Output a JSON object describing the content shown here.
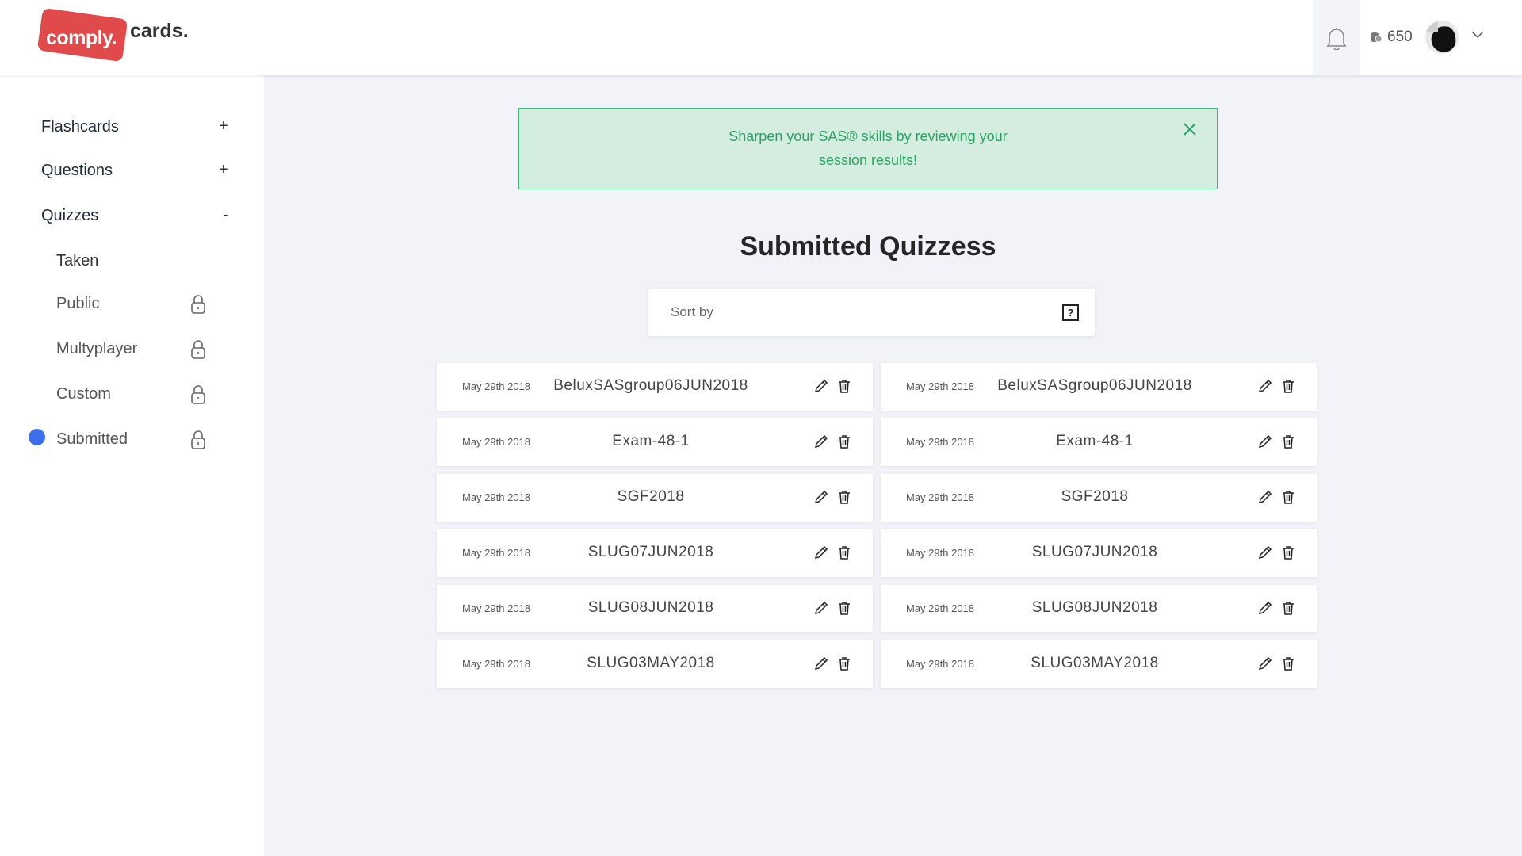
{
  "header": {
    "logo_badge": "comply.",
    "logo_text": "cards.",
    "coins": "650"
  },
  "sidebar": {
    "items": [
      {
        "label": "Flashcards",
        "sign": "+"
      },
      {
        "label": "Questions",
        "sign": "+"
      },
      {
        "label": "Quizzes",
        "sign": "-"
      }
    ],
    "subitems": [
      {
        "label": "Taken",
        "locked": false
      },
      {
        "label": "Public",
        "locked": true
      },
      {
        "label": "Multyplayer",
        "locked": true
      },
      {
        "label": "Custom",
        "locked": true
      },
      {
        "label": "Submitted",
        "locked": true,
        "active": true
      }
    ]
  },
  "alert": {
    "line1": "Sharpen your SAS® skills by reviewing your",
    "line2": "session results!"
  },
  "main": {
    "title": "Submitted Quizzess",
    "sort_placeholder": "Sort by",
    "help_icon": "?"
  },
  "quizzes": [
    {
      "date": "May 29th 2018",
      "name": "BeluxSASgroup06JUN2018"
    },
    {
      "date": "May 29th 2018",
      "name": "BeluxSASgroup06JUN2018"
    },
    {
      "date": "May 29th 2018",
      "name": "Exam-48-1"
    },
    {
      "date": "May 29th 2018",
      "name": "Exam-48-1"
    },
    {
      "date": "May 29th 2018",
      "name": "SGF2018"
    },
    {
      "date": "May 29th 2018",
      "name": "SGF2018"
    },
    {
      "date": "May 29th 2018",
      "name": "SLUG07JUN2018"
    },
    {
      "date": "May 29th 2018",
      "name": "SLUG07JUN2018"
    },
    {
      "date": "May 29th 2018",
      "name": "SLUG08JUN2018"
    },
    {
      "date": "May 29th 2018",
      "name": "SLUG08JUN2018"
    },
    {
      "date": "May 29th 2018",
      "name": "SLUG03MAY2018"
    },
    {
      "date": "May 29th 2018",
      "name": "SLUG03MAY2018"
    }
  ],
  "colors": {
    "brand_red": "#e04a4a",
    "alert_green": "#2aa262",
    "active_dot": "#3b6ee8"
  }
}
